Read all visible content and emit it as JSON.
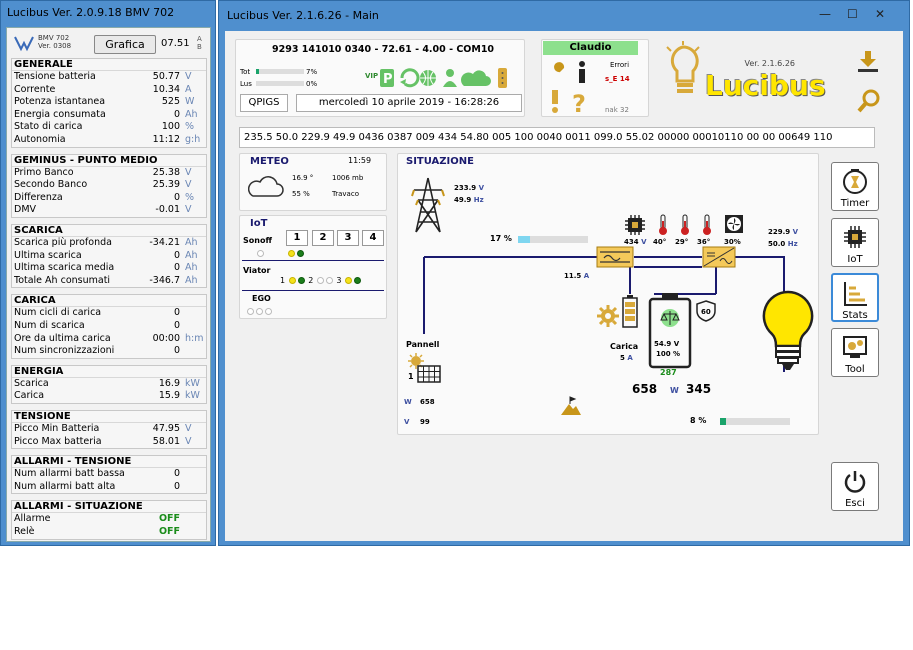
{
  "bmv_window": {
    "title": "Lucibus Ver. 2.0.9.18    BMV 702",
    "model_line1": "BMV 702",
    "model_line2": "Ver. 0308",
    "grafica_label": "Grafica",
    "clock": "07.51",
    "ab_top": "A",
    "ab_bottom": "B",
    "sections": [
      {
        "title": "GENERALE",
        "rows": [
          {
            "label": "Tensione batteria",
            "value": "50.77",
            "unit": "V"
          },
          {
            "label": "Corrente",
            "value": "10.34",
            "unit": "A"
          },
          {
            "label": "Potenza istantanea",
            "value": "525",
            "unit": "W"
          },
          {
            "label": "Energia consumata",
            "value": "0",
            "unit": "Ah"
          },
          {
            "label": "Stato di carica",
            "value": "100",
            "unit": "%"
          },
          {
            "label": "Autonomia",
            "value": "11:12",
            "unit": "g:h"
          }
        ]
      },
      {
        "title": "GEMINUS - PUNTO MEDIO",
        "rows": [
          {
            "label": "Primo Banco",
            "value": "25.38",
            "unit": "V"
          },
          {
            "label": "Secondo Banco",
            "value": "25.39",
            "unit": "V"
          },
          {
            "label": "Differenza",
            "value": "0",
            "unit": "%"
          },
          {
            "label": "DMV",
            "value": "-0.01",
            "unit": "V"
          }
        ]
      },
      {
        "title": "SCARICA",
        "rows": [
          {
            "label": "Scarica più profonda",
            "value": "-34.21",
            "unit": "Ah"
          },
          {
            "label": "Ultima scarica",
            "value": "0",
            "unit": "Ah"
          },
          {
            "label": "Ultima scarica media",
            "value": "0",
            "unit": "Ah"
          },
          {
            "label": "Totale Ah consumati",
            "value": "-346.7",
            "unit": "Ah"
          }
        ]
      },
      {
        "title": "CARICA",
        "rows": [
          {
            "label": "Num cicli di carica",
            "value": "0",
            "unit": ""
          },
          {
            "label": "Num di scarica",
            "value": "0",
            "unit": ""
          },
          {
            "label": "Ore da ultima carica",
            "value": "00:00",
            "unit": "h:m"
          },
          {
            "label": "Num sincronizzazioni",
            "value": "0",
            "unit": ""
          }
        ]
      },
      {
        "title": "ENERGIA",
        "rows": [
          {
            "label": "Scarica",
            "value": "16.9",
            "unit": "kW"
          },
          {
            "label": "Carica",
            "value": "15.9",
            "unit": "kW"
          }
        ]
      },
      {
        "title": "TENSIONE",
        "rows": [
          {
            "label": "Picco Min Batteria",
            "value": "47.95",
            "unit": "V"
          },
          {
            "label": "Picco Max batteria",
            "value": "58.01",
            "unit": "V"
          }
        ]
      },
      {
        "title": "ALLARMI - TENSIONE",
        "rows": [
          {
            "label": "Num allarmi batt bassa",
            "value": "0",
            "unit": ""
          },
          {
            "label": "Num allarmi batt alta",
            "value": "0",
            "unit": ""
          }
        ]
      },
      {
        "title": "ALLARMI - SITUAZIONE",
        "rows": [
          {
            "label": "Allarme",
            "value": "OFF",
            "unit": ""
          },
          {
            "label": "Relè",
            "value": "OFF",
            "unit": ""
          }
        ]
      }
    ]
  },
  "main_window": {
    "title": "Lucibus Ver. 2.1.6.26 - Main",
    "window_controls": {
      "minimize": "—",
      "maximize": "☐",
      "close": "✕"
    },
    "header": {
      "device_line": "9293 141010 0340  -  72.61 - 4.00  -  COM10",
      "tot_label": "Tot",
      "tot_pct": "7%",
      "lus_label": "Lus",
      "lus_pct": "0%",
      "tot_level": 0.07,
      "lus_level": 0.0,
      "vip_label": "VIP",
      "qpigs_label": "QPIGS",
      "datetime": "mercoledì 10 aprile 2019 - 16:28:26",
      "user_label": "Claudio",
      "errori_label": "Errori",
      "error_code": "s_E 14",
      "nak_label": "nak 32",
      "logo_version": "Ver. 2.1.6.26",
      "logo_text": "Lucibus"
    },
    "raw_data": "235.5 50.0 229.9 49.9 0436 0387 009 434 54.80 005 100 0040 0011 099.0 55.02 00000 00010110 00 00 00649 110",
    "meteo": {
      "title": "METEO",
      "time": "11:59",
      "temp": "16.9 °",
      "pressure": "1006 mb",
      "humidity": "55 %",
      "location": "Travaco"
    },
    "iot": {
      "title": "IoT",
      "sonoff_label": "Sonoff",
      "sonoff_buttons": [
        "1",
        "2",
        "3",
        "4"
      ],
      "viator_label": "Viator",
      "viator_items": [
        "1",
        "2",
        "3"
      ],
      "ego_label": "EGO"
    },
    "situazione": {
      "title": "SITUAZIONE",
      "grid_voltage": "233.9",
      "grid_freq": "49.9",
      "unit_v": "V",
      "unit_hz": "Hz",
      "grid_pct": "17 %",
      "grid_level": 0.17,
      "charger_current": "11.5",
      "unit_a": "A",
      "inverter_v": "434",
      "temp1": "40°",
      "temp2": "29°",
      "temp3": "36°",
      "fan_pct": "30%",
      "out_voltage": "229.9",
      "out_freq": "50.0",
      "pannelli_label": "Pannell",
      "pannelli_count": "1",
      "pv_w_label": "W",
      "pv_w": "658",
      "pv_v_label": "V",
      "pv_v": "99",
      "carica_label": "Carica",
      "carica_current": "5",
      "battery_v": "54.9 V",
      "battery_pct": "100 %",
      "battery_badge": "60",
      "charge_power": "287",
      "power_in": "658",
      "power_w_label": "W",
      "power_out": "345",
      "load_pct": "8 %",
      "load_level": 0.08
    },
    "buttons": {
      "timer": "Timer",
      "iot": "IoT",
      "stats": "Stats",
      "tool": "Tool",
      "esci": "Esci"
    },
    "colors": {
      "accent_green": "#8de08d",
      "error_red": "#cc0000",
      "flow_line": "#1a1a6e",
      "gold": "#c8961a",
      "bulb_yellow": "#ffe600"
    }
  }
}
